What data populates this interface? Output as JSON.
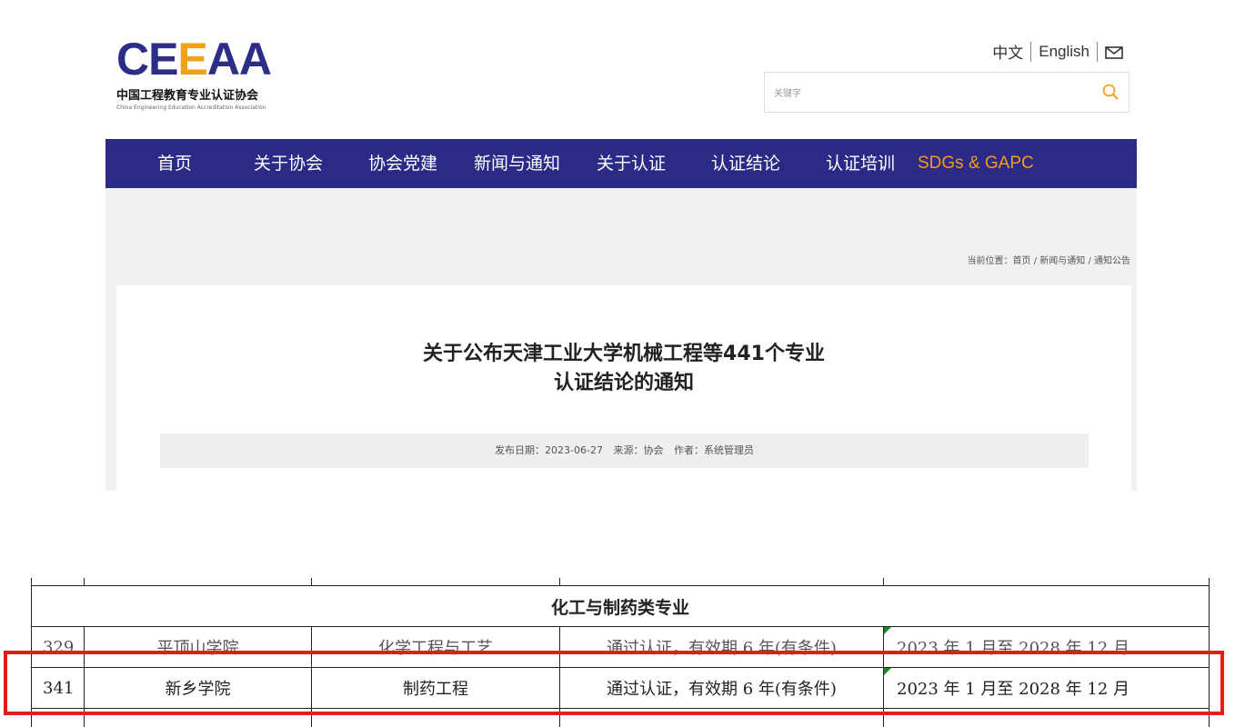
{
  "header": {
    "logo_text_1": "CE",
    "logo_text_2": "E",
    "logo_text_3": "AA",
    "logo_cn": "中国工程教育专业认证协会",
    "logo_en": "China Engineering Education Accreditation Association",
    "lang_cn": "中文",
    "lang_en": "English",
    "search_placeholder": "关键字"
  },
  "nav": {
    "items": [
      "首页",
      "关于协会",
      "协会党建",
      "新闻与通知",
      "关于认证",
      "认证结论",
      "认证培训",
      "SDGs & GAPC"
    ]
  },
  "breadcrumb": {
    "prefix": "当前位置：",
    "home": "首页",
    "sep": " / ",
    "news": "新闻与通知",
    "current": "通知公告"
  },
  "article": {
    "title_line1": "关于公布天津工业大学机械工程等441个专业",
    "title_line2": "认证结论的通知",
    "date": "发布日期：2023-06-27",
    "source": "来源：协会",
    "author": "作者：系统管理员"
  },
  "table": {
    "section": "化工与制药类专业",
    "rows": [
      {
        "num": "329",
        "school": "平顶山学院",
        "major": "化学工程与工艺",
        "result": "通过认证，有效期 6 年(有条件)",
        "period": "2023 年 1 月至 2028 年 12 月"
      },
      {
        "num": "341",
        "school": "新乡学院",
        "major": "制药工程",
        "result": "通过认证，有效期 6 年(有条件)",
        "period": "2023 年 1 月至 2028 年 12 月"
      }
    ]
  },
  "colors": {
    "nav_bg": "#2b2a86",
    "accent": "#f39a21",
    "highlight": "#e41b17"
  }
}
